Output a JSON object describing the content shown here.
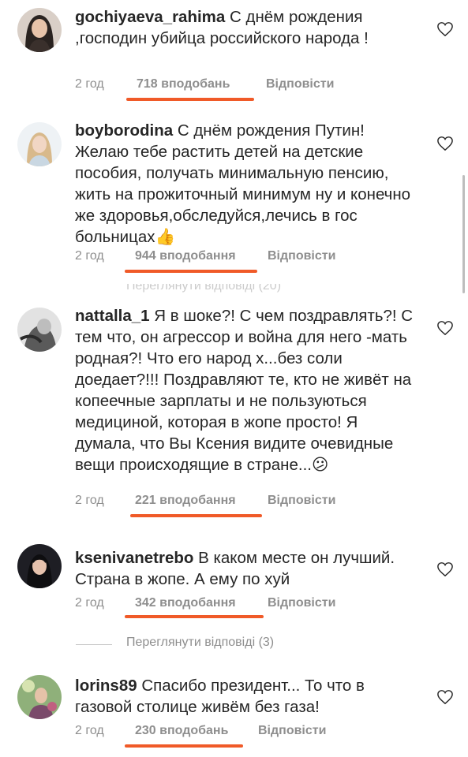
{
  "comments": [
    {
      "username": "gochiyaeva_rahima",
      "text": "С днём рождения ,господин убийца российского народа !",
      "time": "2 год",
      "likes": "718 вподобань",
      "reply": "Відповісти"
    },
    {
      "username": "boyborodina",
      "text": "С днём рождения Путин! Желаю тебе растить детей на детские пособия, получать минимальную пенсию, жить на прожиточный минимум ну и конечно же здоровья,обследуйся,лечись в гос больницах👍",
      "time": "2 год",
      "likes": "944 вподобання",
      "reply": "Відповісти",
      "view_replies_faded": "Переглянути відповіді (20)"
    },
    {
      "username": "nattalla_1",
      "text": "Я в шоке?! С чем поздравлять?! С тем что, он агрессор и война для него -мать родная?! Что его народ х...без соли доедает?!!! Поздравляют те, кто не живёт на копеечные зарплаты и не пользуються медициной, которая в жопе просто! Я думала, что Вы Ксения видите очевидные вещи происходящие в стране...😕",
      "time": "2 год",
      "likes": "221 вподобання",
      "reply": "Відповісти"
    },
    {
      "username": "ksenivanetrebo",
      "text": "В каком месте он лучший. Страна в жопе. А ему по хуй",
      "time": "2 год",
      "likes": "342 вподобання",
      "reply": "Відповісти",
      "view_replies": "Переглянути відповіді (3)"
    },
    {
      "username": "lorins89",
      "text": "Спасибо президент... То что в газовой столице живём без газа!",
      "time": "2 год",
      "likes": "230 вподобань",
      "reply": "Відповісти"
    }
  ],
  "icons": {
    "like": "heart-outline-icon"
  },
  "colors": {
    "highlight_underline": "#f05a28",
    "meta_text": "#8e8e8e",
    "body_text": "#262626"
  }
}
